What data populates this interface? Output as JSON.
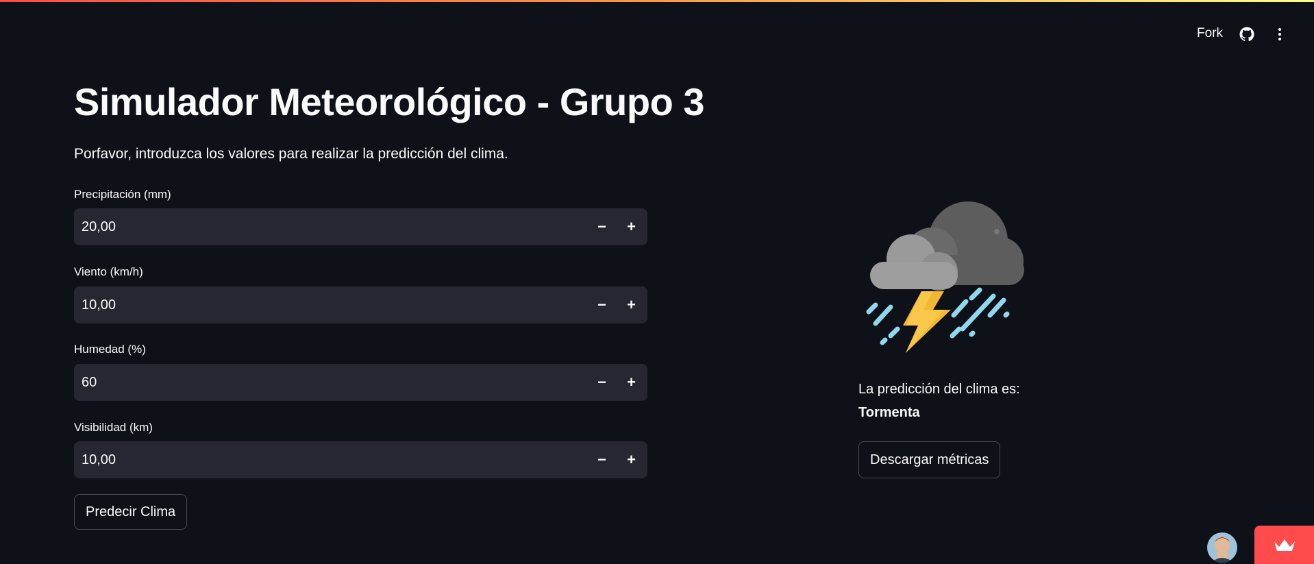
{
  "header": {
    "fork_label": "Fork",
    "icons": [
      "github-icon",
      "more-vertical-icon"
    ]
  },
  "main": {
    "title": "Simulador Meteorológico - Grupo 3",
    "subtitle": "Porfavor, introduzca los valores para realizar la predicción del clima.",
    "fields": [
      {
        "label": "Precipitación (mm)",
        "value": "20,00"
      },
      {
        "label": "Viento (km/h)",
        "value": "10,00"
      },
      {
        "label": "Humedad (%)",
        "value": "60"
      },
      {
        "label": "Visibilidad (km)",
        "value": "10,00"
      }
    ],
    "stepper": {
      "decrement": "−",
      "increment": "+"
    },
    "predict_button": "Predecir Clima"
  },
  "result": {
    "icon": "thunderstorm-icon",
    "label": "La predicción del clima es:",
    "value": "Tormenta",
    "download_button": "Descargar métricas"
  },
  "colors": {
    "background": "#0e1117",
    "input_bg": "#262730",
    "accent": "#ff4b4b"
  }
}
